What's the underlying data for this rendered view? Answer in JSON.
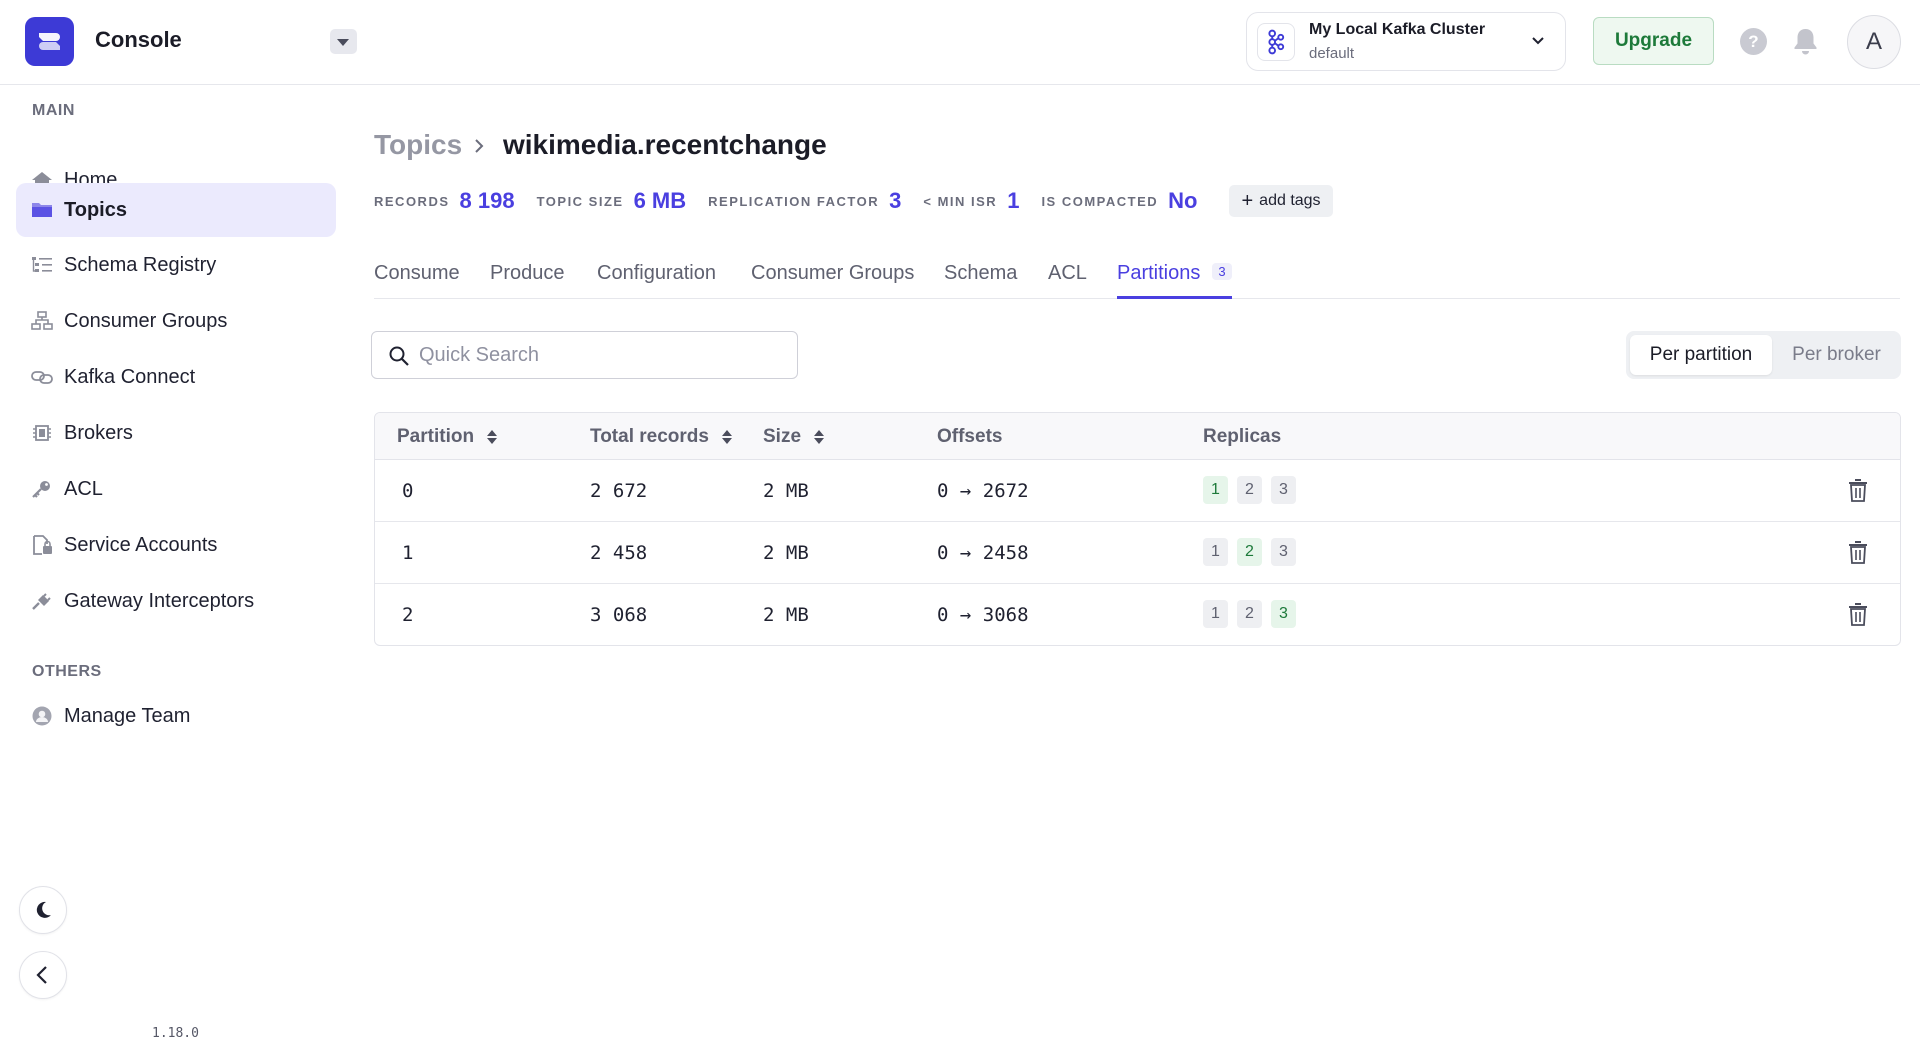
{
  "app": {
    "title": "Console"
  },
  "cluster": {
    "name": "My Local Kafka Cluster",
    "environment": "default"
  },
  "header": {
    "upgrade_label": "Upgrade",
    "help_label": "?",
    "avatar_initial": "A"
  },
  "sidebar": {
    "main_section": "MAIN",
    "items": [
      {
        "label": "Home",
        "icon": "home-icon"
      },
      {
        "label": "Topics",
        "icon": "folder-icon",
        "active": true
      },
      {
        "label": "Schema Registry",
        "icon": "schema-icon"
      },
      {
        "label": "Consumer Groups",
        "icon": "hierarchy-icon"
      },
      {
        "label": "Kafka Connect",
        "icon": "link-icon"
      },
      {
        "label": "Brokers",
        "icon": "chip-icon"
      },
      {
        "label": "ACL",
        "icon": "key-icon"
      },
      {
        "label": "Service Accounts",
        "icon": "lock-file-icon"
      },
      {
        "label": "Gateway Interceptors",
        "icon": "plug-icon"
      }
    ],
    "others_section": "OTHERS",
    "other_items": [
      {
        "label": "Manage Team",
        "icon": "user-icon"
      }
    ],
    "version": "1.18.0"
  },
  "breadcrumb": {
    "parent": "Topics",
    "current": "wikimedia.recentchange"
  },
  "stats": {
    "records_label": "RECORDS",
    "records_value": "8 198",
    "size_label": "TOPIC SIZE",
    "size_value": "6 MB",
    "replication_label": "REPLICATION FACTOR",
    "replication_value": "3",
    "minisr_label": "< MIN ISR",
    "minisr_value": "1",
    "compacted_label": "IS COMPACTED",
    "compacted_value": "No",
    "add_tags_label": "add tags"
  },
  "tabs": [
    {
      "label": "Consume"
    },
    {
      "label": "Produce"
    },
    {
      "label": "Configuration"
    },
    {
      "label": "Consumer Groups"
    },
    {
      "label": "Schema"
    },
    {
      "label": "ACL"
    },
    {
      "label": "Partitions",
      "count": "3",
      "active": true
    }
  ],
  "search": {
    "placeholder": "Quick Search",
    "value": ""
  },
  "view_toggle": {
    "options": [
      "Per partition",
      "Per broker"
    ],
    "selected": "Per partition"
  },
  "table": {
    "columns": [
      "Partition",
      "Total records",
      "Size",
      "Offsets",
      "Replicas"
    ],
    "rows": [
      {
        "partition": "0",
        "total_records": "2 672",
        "size": "2 MB",
        "offsets": "0 → 2672",
        "replicas": [
          "1",
          "2",
          "3"
        ],
        "leader": "1"
      },
      {
        "partition": "1",
        "total_records": "2 458",
        "size": "2 MB",
        "offsets": "0 → 2458",
        "replicas": [
          "1",
          "2",
          "3"
        ],
        "leader": "2"
      },
      {
        "partition": "2",
        "total_records": "3 068",
        "size": "2 MB",
        "offsets": "0 → 3068",
        "replicas": [
          "1",
          "2",
          "3"
        ],
        "leader": "3"
      }
    ]
  },
  "colors": {
    "accent": "#4a3fe0",
    "brand": "#3d3ad6",
    "leader_green": "#1d7a3a",
    "active_nav_bg": "#ebeafd"
  }
}
